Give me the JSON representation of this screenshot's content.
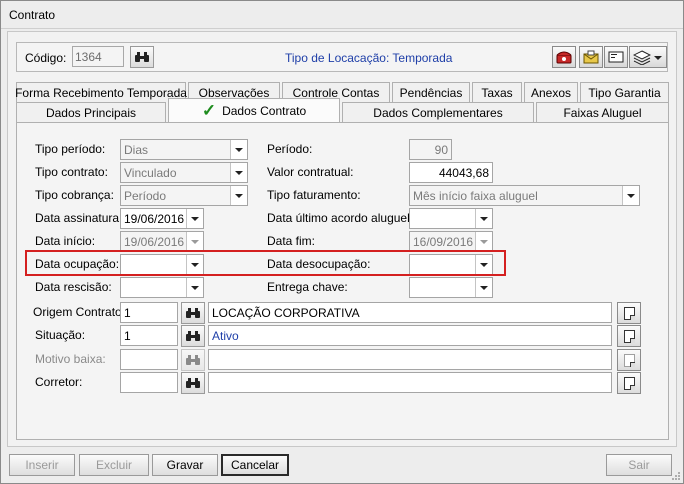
{
  "window": {
    "title": "Contrato"
  },
  "header": {
    "code_label": "Código:",
    "code_value": "1364",
    "locacao_text": "Tipo de Locacação: Temporada"
  },
  "tabs_row1": [
    "Forma Recebimento Temporada",
    "Observações",
    "Controle Contas",
    "Pendências",
    "Taxas",
    "Anexos",
    "Tipo Garantia"
  ],
  "tabs_row2": [
    "Dados Principais",
    "Dados Contrato",
    "Dados Complementares",
    "Faixas Aluguel"
  ],
  "active_tab": "Dados Contrato",
  "form": {
    "tipo_periodo": {
      "label": "Tipo período:",
      "value": "Dias"
    },
    "tipo_contrato": {
      "label": "Tipo contrato:",
      "value": "Vinculado"
    },
    "tipo_cobranca": {
      "label": "Tipo cobrança:",
      "value": "Período"
    },
    "data_assinatura": {
      "label": "Data assinatura:",
      "value": "19/06/2016"
    },
    "data_inicio": {
      "label": "Data início:",
      "value": "19/06/2016"
    },
    "data_ocupacao": {
      "label": "Data ocupação:",
      "value": ""
    },
    "data_rescisao": {
      "label": "Data rescisão:",
      "value": ""
    },
    "periodo": {
      "label": "Período:",
      "value": "90"
    },
    "valor_contratual": {
      "label": "Valor contratual:",
      "value": "44043,68"
    },
    "tipo_faturamento": {
      "label": "Tipo faturamento:",
      "value": "Mês início faixa aluguel"
    },
    "data_ultimo_acordo": {
      "label": "Data último acordo aluguel:",
      "value": ""
    },
    "data_fim": {
      "label": "Data fim:",
      "value": "16/09/2016"
    },
    "data_desocupacao": {
      "label": "Data desocupação:",
      "value": ""
    },
    "entrega_chave": {
      "label": "Entrega chave:",
      "value": ""
    },
    "origem_contrato": {
      "label": "Origem Contrato:",
      "code": "1",
      "desc": "LOCAÇÃO CORPORATIVA"
    },
    "situacao": {
      "label": "Situação:",
      "code": "1",
      "desc": "Ativo"
    },
    "motivo_baixa": {
      "label": "Motivo baixa:",
      "code": "",
      "desc": ""
    },
    "corretor": {
      "label": "Corretor:",
      "code": "",
      "desc": ""
    }
  },
  "buttons": {
    "inserir": "Inserir",
    "excluir": "Excluir",
    "gravar": "Gravar",
    "cancelar": "Cancelar",
    "sair": "Sair"
  },
  "colors": {
    "accent_blue": "#1f3fa8",
    "highlight_red": "#d42020",
    "check_green": "#1e8c1e"
  }
}
